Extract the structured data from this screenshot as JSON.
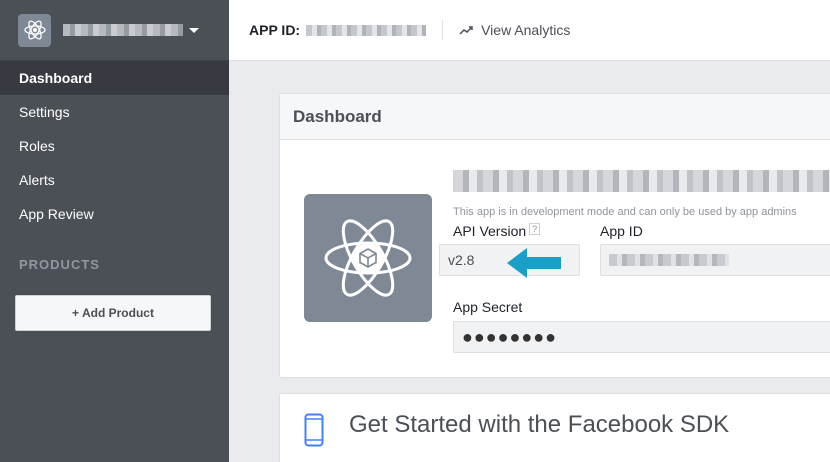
{
  "sidebar": {
    "items": [
      {
        "label": "Dashboard",
        "active": true
      },
      {
        "label": "Settings"
      },
      {
        "label": "Roles"
      },
      {
        "label": "Alerts"
      },
      {
        "label": "App Review"
      }
    ],
    "products_label": "PRODUCTS",
    "add_product_label": "+ Add Product"
  },
  "topbar": {
    "app_id_label": "APP ID:",
    "view_analytics_label": "View Analytics"
  },
  "dashboard": {
    "title": "Dashboard",
    "dev_mode_text": "This app is in development mode and can only be used by app admins",
    "api_version_label": "API Version",
    "api_version_help": "?",
    "api_version_value": "v2.8",
    "app_id_label": "App ID",
    "app_secret_label": "App Secret",
    "app_secret_value": "●●●●●●●●"
  },
  "sdk": {
    "title": "Get Started with the Facebook SDK"
  },
  "colors": {
    "sidebar_bg": "#4b4f56",
    "sidebar_active": "#373b41",
    "arrow": "#1a9fc9",
    "sdk_icon": "#4080ff"
  },
  "icons": {
    "app_icon": "atom-cube-icon",
    "analytics_icon": "trend-arrow-icon",
    "sdk_icon": "mobile-phone-icon"
  }
}
